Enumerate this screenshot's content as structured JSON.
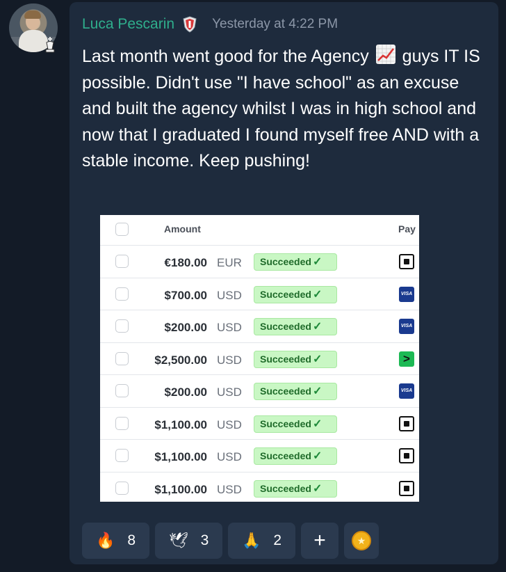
{
  "post": {
    "author": "Luca Pescarin",
    "timestamp": "Yesterday at 4:22 PM",
    "message_part1": "Last month went good for the Agency",
    "message_part2": " guys IT IS possible. Didn't use \"I have school\" as an excuse and built the agency whilst I was in high school and now that I graduated I found myself free AND with a stable income. Keep pushing!",
    "inline_emoji": "chart-increasing-icon"
  },
  "attachment": {
    "headers": {
      "amount": "Amount",
      "payment": "Pay"
    },
    "rows": [
      {
        "amount": "€180.00",
        "currency": "EUR",
        "status": "Succeeded",
        "method": "card"
      },
      {
        "amount": "$700.00",
        "currency": "USD",
        "status": "Succeeded",
        "method": "visa"
      },
      {
        "amount": "$200.00",
        "currency": "USD",
        "status": "Succeeded",
        "method": "visa"
      },
      {
        "amount": "$2,500.00",
        "currency": "USD",
        "status": "Succeeded",
        "method": "link"
      },
      {
        "amount": "$200.00",
        "currency": "USD",
        "status": "Succeeded",
        "method": "visa"
      },
      {
        "amount": "$1,100.00",
        "currency": "USD",
        "status": "Succeeded",
        "method": "card"
      },
      {
        "amount": "$1,100.00",
        "currency": "USD",
        "status": "Succeeded",
        "method": "card"
      },
      {
        "amount": "$1,100.00",
        "currency": "USD",
        "status": "Succeeded",
        "method": "card"
      }
    ],
    "visa_label": "VISA",
    "link_glyph": ">",
    "check_glyph": "✓"
  },
  "reactions": [
    {
      "icon": "fire-icon",
      "emoji": "🔥",
      "count": "8"
    },
    {
      "icon": "dove-icon",
      "emoji": "🕊",
      "count": "3"
    },
    {
      "icon": "pray-icon",
      "emoji": "🙏",
      "count": "2"
    }
  ],
  "add_reaction_label": "+",
  "colors": {
    "background": "#131b27",
    "card": "#1e2b3d",
    "author": "#2fae8c",
    "timestamp": "#8c97a8",
    "reaction_bg": "#2b3a4f",
    "status_bg": "#c9f7c4"
  }
}
